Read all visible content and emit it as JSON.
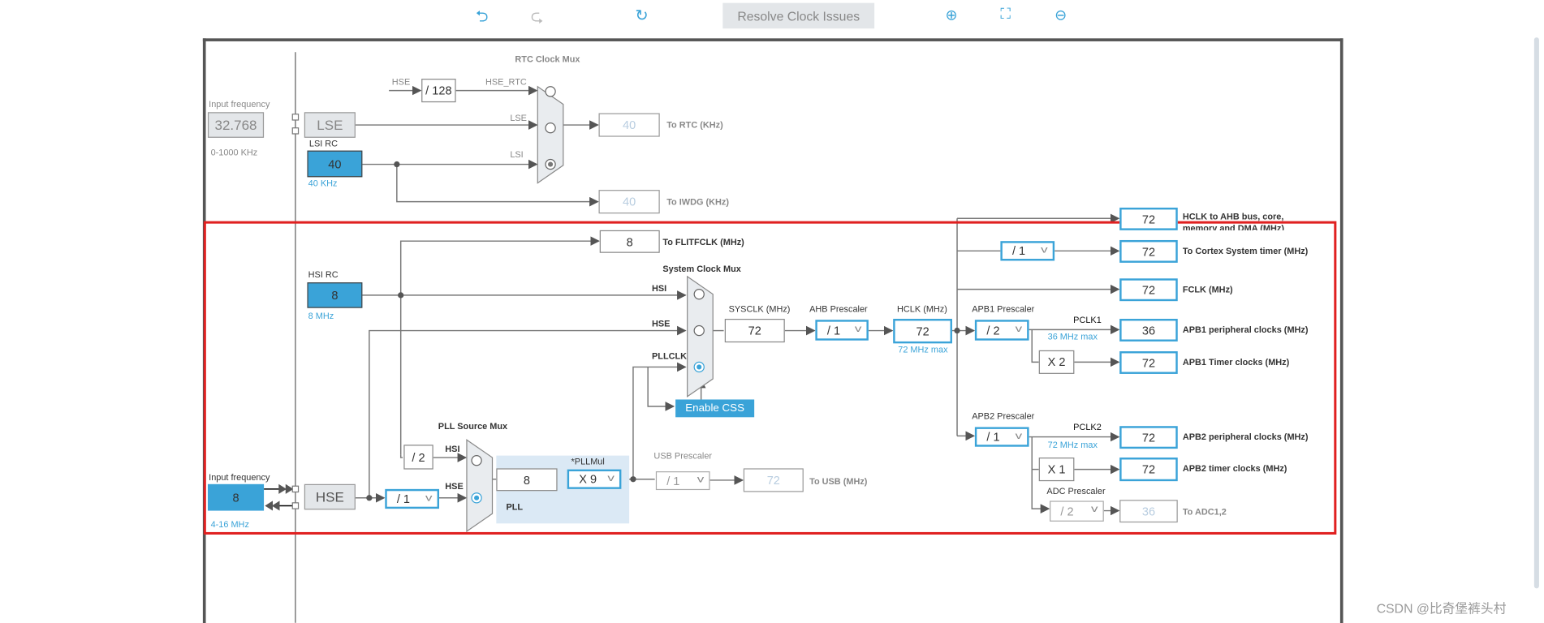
{
  "toolbar": {
    "undo_icon": "undo-icon",
    "redo_icon": "redo-icon",
    "reset_icon": "refresh-icon",
    "resolve": "Resolve Clock Issues",
    "zoom_in_icon": "zoom-in-icon",
    "fit_icon": "fit-screen-icon",
    "zoom_out_icon": "zoom-out-icon"
  },
  "rtc": {
    "input_label": "Input frequency",
    "lse_freq": "32.768",
    "lse_range": "0-1000 KHz",
    "lse": "LSE",
    "lsi_rc": "LSI RC",
    "lsi_value": "40",
    "lsi_freq": "40 KHz",
    "hse_in": "HSE",
    "div128": "/ 128",
    "hse_rtc": "HSE_RTC",
    "mux_title": "RTC Clock Mux",
    "lse_wire": "LSE",
    "lsi_wire": "LSI",
    "rtc_value": "40",
    "rtc_label": "To RTC (KHz)",
    "iwdg_value": "40",
    "iwdg_label": "To IWDG (KHz)"
  },
  "sys": {
    "flit_value": "8",
    "flit_label": "To FLITFCLK (MHz)",
    "hsi_rc": "HSI RC",
    "hsi_value": "8",
    "hsi_freq": "8 MHz",
    "mux_title": "System Clock Mux",
    "hsi_wire": "HSI",
    "hse_wire": "HSE",
    "pllclk_wire": "PLLCLK",
    "enable_css": "Enable CSS",
    "sysclk_label": "SYSCLK (MHz)",
    "sysclk_value": "72",
    "ahb_label": "AHB Prescaler",
    "ahb_value": "/ 1",
    "hclk_label": "HCLK (MHz)",
    "hclk_value": "72",
    "hclk_max": "72 MHz max"
  },
  "outputs": {
    "ahb_value": "72",
    "ahb_label1": "HCLK to AHB bus, core,",
    "ahb_label2": "memory and DMA (MHz)",
    "cortex_div": "/ 1",
    "cortex_value": "72",
    "cortex_label": "To Cortex System timer (MHz)",
    "fclk_value": "72",
    "fclk_label": "FCLK (MHz)",
    "apb1_label": "APB1 Prescaler",
    "apb1_div": "/ 2",
    "pclk1": "PCLK1",
    "apb1_max": "36 MHz max",
    "apb1_value": "36",
    "apb1_periph_label": "APB1 peripheral clocks (MHz)",
    "apb1_mul": "X 2",
    "apb1_timer_value": "72",
    "apb1_timer_label": "APB1 Timer clocks (MHz)",
    "apb2_label": "APB2 Prescaler",
    "apb2_div": "/ 1",
    "pclk2": "PCLK2",
    "apb2_max": "72 MHz max",
    "apb2_value": "72",
    "apb2_periph_label": "APB2 peripheral clocks (MHz)",
    "apb2_mul": "X 1",
    "apb2_timer_value": "72",
    "apb2_timer_label": "APB2 timer clocks (MHz)",
    "adc_label": "ADC Prescaler",
    "adc_div": "/ 2",
    "adc_value": "36",
    "adc_out_label": "To ADC1,2"
  },
  "pll": {
    "input_label": "Input frequency",
    "hse_value": "8",
    "hse_range": "4-16 MHz",
    "hse": "HSE",
    "hse_div": "/ 1",
    "mux_title": "PLL Source Mux",
    "hsi_div": "/ 2",
    "hsi_wire": "HSI",
    "hse_wire": "HSE",
    "pll_in": "8",
    "pllmul_label": "*PLLMul",
    "pllmul": "X 9",
    "pll_label": "PLL",
    "usb_label": "USB Prescaler",
    "usb_div": "/ 1",
    "usb_value": "72",
    "usb_out_label": "To USB (MHz)"
  },
  "watermark": "CSDN @比奇堡裤头村",
  "colors": {
    "accent": "#3aa3d8",
    "highlight": "#e02020"
  }
}
